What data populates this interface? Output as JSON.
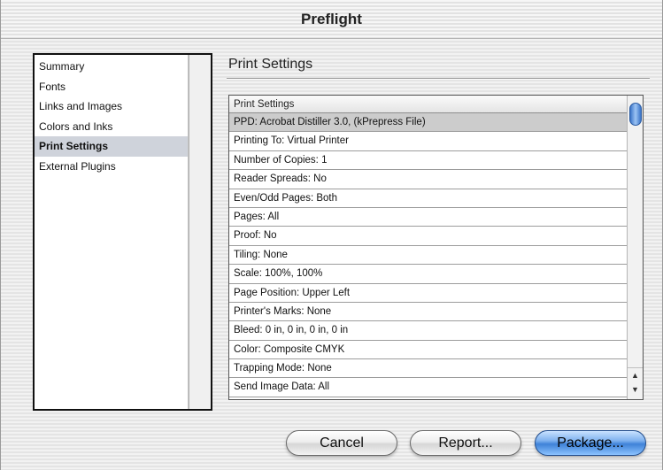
{
  "window": {
    "title": "Preflight"
  },
  "sidebar": {
    "items": [
      {
        "label": "Summary",
        "selected": false
      },
      {
        "label": "Fonts",
        "selected": false
      },
      {
        "label": "Links and Images",
        "selected": false
      },
      {
        "label": "Colors and Inks",
        "selected": false
      },
      {
        "label": "Print Settings",
        "selected": true
      },
      {
        "label": "External Plugins",
        "selected": false
      }
    ]
  },
  "section": {
    "title": "Print Settings"
  },
  "table": {
    "header": "Print Settings",
    "rows": [
      {
        "text": "PPD: Acrobat Distiller 3.0, (kPrepress File)",
        "selected": true
      },
      {
        "text": "Printing To: Virtual Printer",
        "selected": false
      },
      {
        "text": "Number of Copies: 1",
        "selected": false
      },
      {
        "text": "Reader Spreads: No",
        "selected": false
      },
      {
        "text": "Even/Odd Pages: Both",
        "selected": false
      },
      {
        "text": "Pages: All",
        "selected": false
      },
      {
        "text": "Proof: No",
        "selected": false
      },
      {
        "text": "Tiling: None",
        "selected": false
      },
      {
        "text": "Scale: 100%, 100%",
        "selected": false
      },
      {
        "text": "Page Position: Upper Left",
        "selected": false
      },
      {
        "text": "Printer's Marks: None",
        "selected": false
      },
      {
        "text": "Bleed: 0 in, 0 in, 0 in, 0 in",
        "selected": false
      },
      {
        "text": "Color: Composite CMYK",
        "selected": false
      },
      {
        "text": "Trapping Mode: None",
        "selected": false
      },
      {
        "text": "Send Image Data: All",
        "selected": false
      }
    ],
    "scroll_up_icon": "▲",
    "scroll_down_icon": "▼"
  },
  "buttons": {
    "cancel": "Cancel",
    "report": "Report...",
    "package": "Package..."
  },
  "colors": {
    "selection": "#cfd3db",
    "default_button": "#3f82d8"
  }
}
